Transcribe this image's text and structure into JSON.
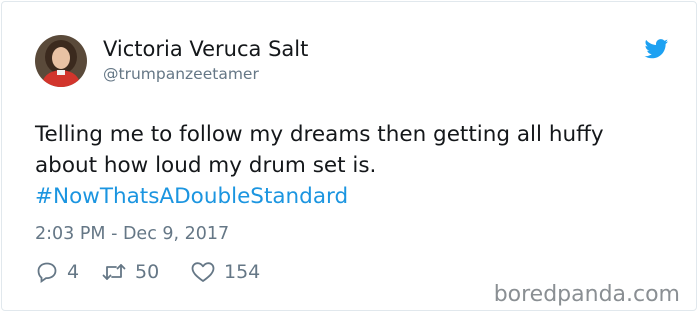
{
  "tweet": {
    "author_name": "Victoria Veruca Salt",
    "author_handle": "@trumpanzeetamer",
    "text_line1": "Telling me to follow my dreams then getting all huffy",
    "text_line2": "about how loud my drum set is.",
    "hashtag": "#NowThatsADoubleStandard",
    "timestamp": "2:03 PM - Dec 9, 2017",
    "replies": "4",
    "retweets": "50",
    "likes": "154"
  },
  "icons": {
    "brand": "twitter-bird-icon",
    "reply": "reply-icon",
    "retweet": "retweet-icon",
    "like": "heart-icon"
  },
  "colors": {
    "twitter_blue": "#1da1f2",
    "hashtag": "#1b95e0",
    "muted": "#657786",
    "text": "#14171a"
  },
  "watermark": "boredpanda.com"
}
